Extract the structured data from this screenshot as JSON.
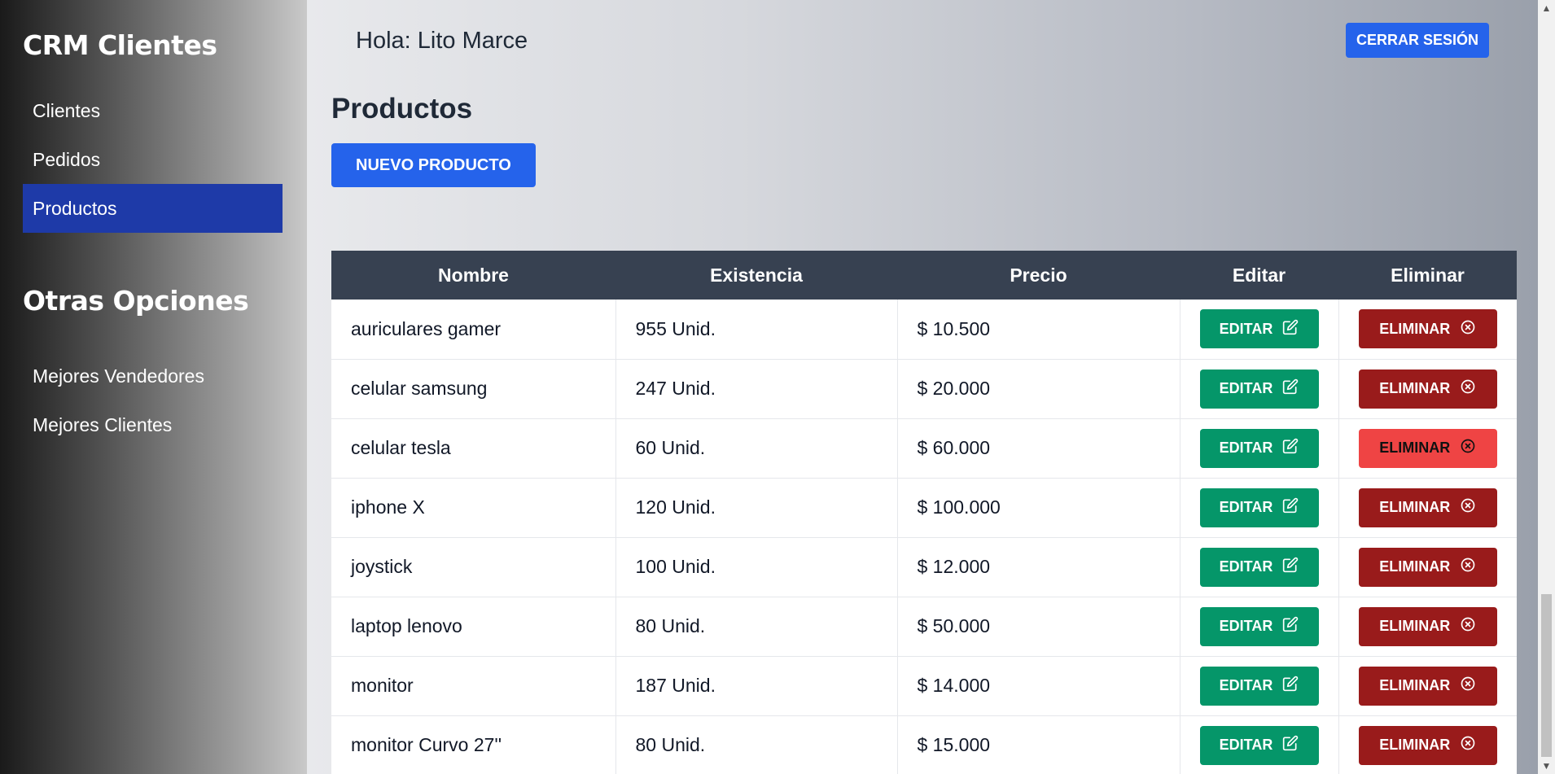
{
  "sidebar": {
    "brand": "CRM Clientes",
    "items": [
      {
        "label": "Clientes"
      },
      {
        "label": "Pedidos"
      },
      {
        "label": "Productos"
      }
    ],
    "section_title": "Otras Opciones",
    "other_items": [
      {
        "label": "Mejores Vendedores"
      },
      {
        "label": "Mejores Clientes"
      }
    ]
  },
  "header": {
    "greeting": "Hola: Lito Marce",
    "logout_label": "Cerrar Sesión"
  },
  "main": {
    "title": "Productos",
    "new_button_label": "Nuevo Producto"
  },
  "table": {
    "columns": [
      "Nombre",
      "Existencia",
      "Precio",
      "Editar",
      "Eliminar"
    ],
    "edit_label": "Editar",
    "delete_label": "Eliminar",
    "rows": [
      {
        "name": "auriculares gamer",
        "stock": "955 Unid.",
        "price": "$ 10.500"
      },
      {
        "name": "celular samsung",
        "stock": "247 Unid.",
        "price": "$ 20.000"
      },
      {
        "name": "celular tesla",
        "stock": "60 Unid.",
        "price": "$ 60.000"
      },
      {
        "name": "iphone X",
        "stock": "120 Unid.",
        "price": "$ 100.000"
      },
      {
        "name": "joystick",
        "stock": "100 Unid.",
        "price": "$ 12.000"
      },
      {
        "name": "laptop lenovo",
        "stock": "80 Unid.",
        "price": "$ 50.000"
      },
      {
        "name": "monitor",
        "stock": "187 Unid.",
        "price": "$ 14.000"
      },
      {
        "name": "monitor Curvo 27''",
        "stock": "80 Unid.",
        "price": "$ 15.000"
      }
    ]
  },
  "colors": {
    "accent": "#2563eb",
    "edit": "#059669",
    "delete": "#991b1b",
    "delete_hover": "#ef4444",
    "active_nav": "#1e3aa8"
  }
}
